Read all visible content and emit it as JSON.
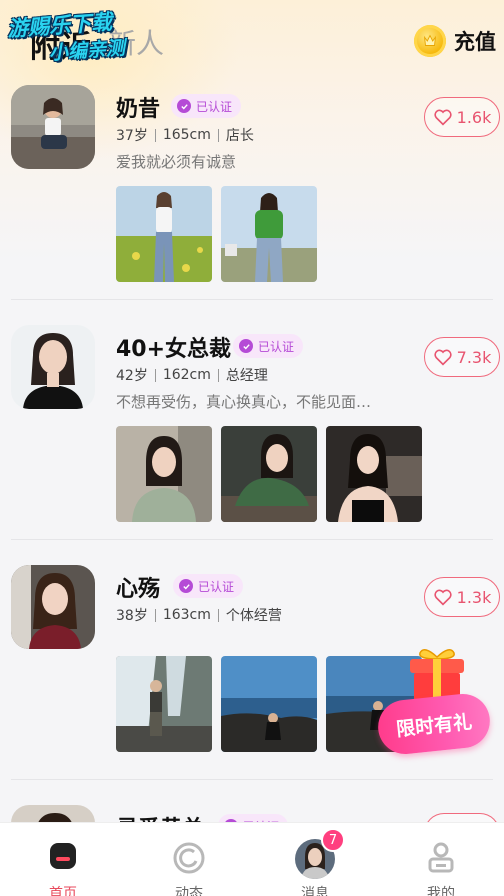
{
  "header": {
    "tab_nearby": "附近",
    "tab_new": "新人",
    "watermark_line1": "游赐乐下载",
    "watermark_line2": "小编亲测",
    "recharge_label": "充值",
    "coin_icon": "coin-icon"
  },
  "cards": [
    {
      "name": "奶昔",
      "badge": "已认证",
      "age": "37岁",
      "height": "165cm",
      "job": "店长",
      "bio": "爱我就必须有诚意",
      "likes": "1.6k"
    },
    {
      "name": "40+女总裁",
      "badge": "已认证",
      "age": "42岁",
      "height": "162cm",
      "job": "总经理",
      "bio": "不想再受伤，真心换真心，不能见面…",
      "likes": "7.3k"
    },
    {
      "name": "心殇",
      "badge": "已认证",
      "age": "38岁",
      "height": "163cm",
      "job": "个体经营",
      "bio": "",
      "likes": "1.3k"
    },
    {
      "name": "寻爱黄总",
      "badge": "已认证"
    }
  ],
  "gift": {
    "label": "限时有礼"
  },
  "tabbar": {
    "home": "首页",
    "moments": "动态",
    "messages": "消息",
    "messages_badge": "7",
    "mine": "我的"
  },
  "colors": {
    "accent": "#e84a5c",
    "badge_purple": "#b54bd6",
    "like_pink": "#f06a7d"
  }
}
